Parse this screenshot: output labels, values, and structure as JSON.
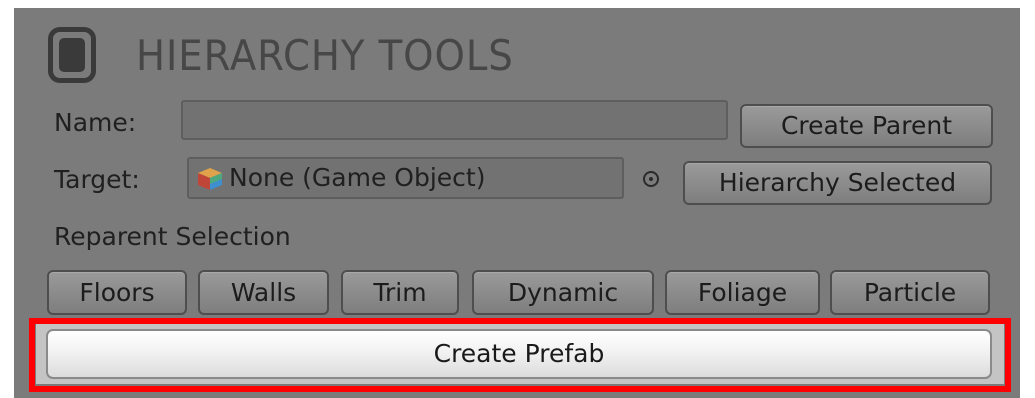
{
  "header": {
    "title": "HIERARCHY TOOLS",
    "icon": "window-icon"
  },
  "name_row": {
    "label": "Name:",
    "value": "",
    "button": "Create Parent"
  },
  "target_row": {
    "label": "Target:",
    "value": "None (Game Object)",
    "icon": "cube-icon",
    "picker_icon": "object-picker-icon",
    "button": "Hierarchy Selected"
  },
  "reparent": {
    "label": "Reparent Selection",
    "buttons": [
      "Floors",
      "Walls",
      "Trim",
      "Dynamic",
      "Foliage",
      "Particle"
    ]
  },
  "prefab": {
    "button": "Create Prefab"
  },
  "colors": {
    "panel": "#7b7b7b",
    "highlight": "#ff0000"
  }
}
